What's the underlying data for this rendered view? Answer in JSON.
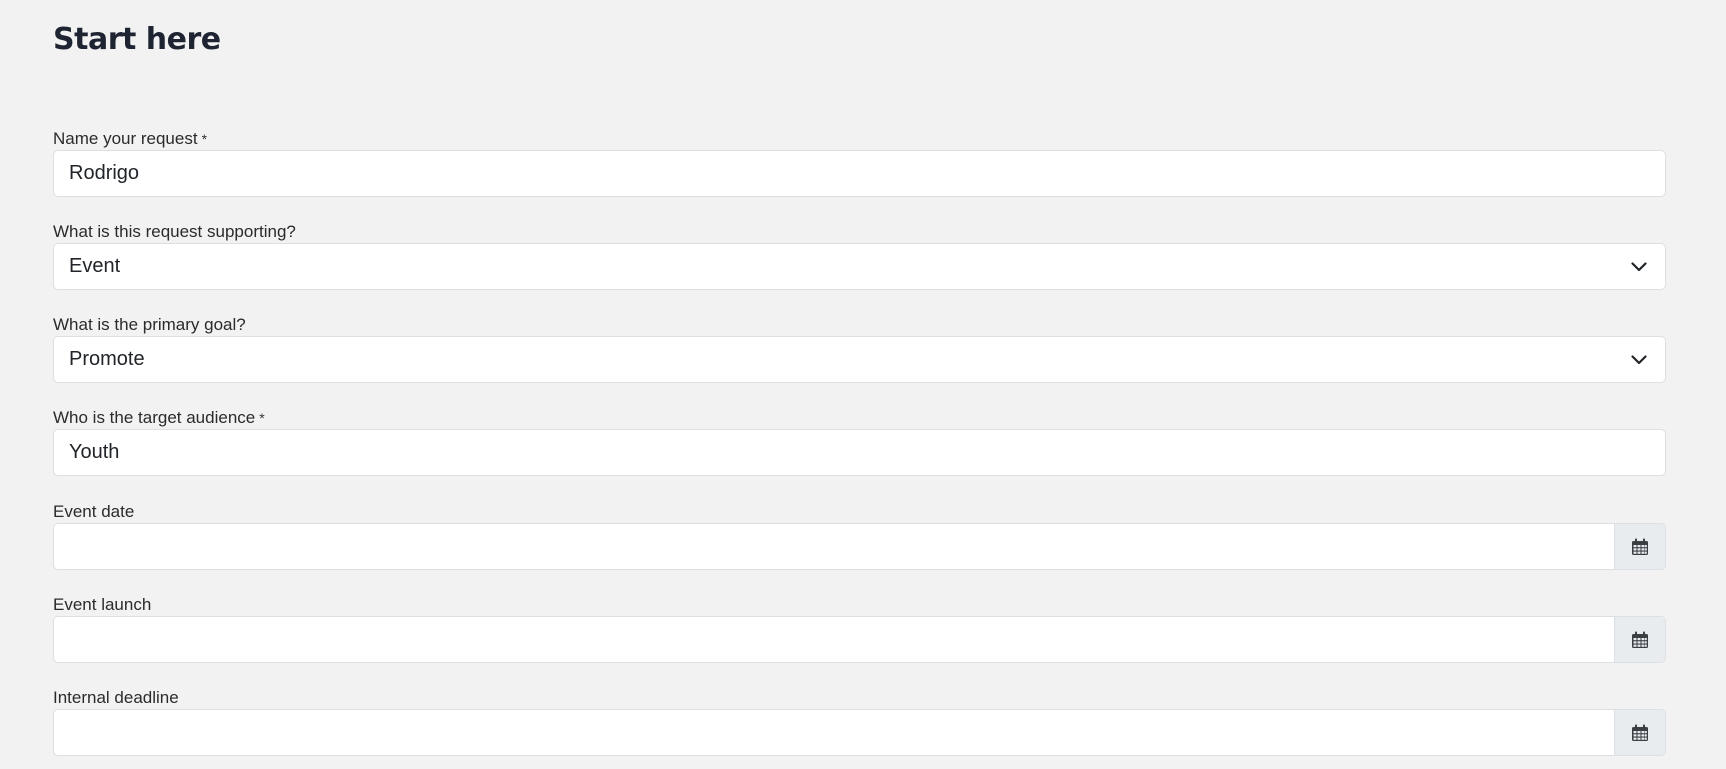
{
  "page": {
    "title": "Start here"
  },
  "form": {
    "request_name": {
      "label": "Name your request",
      "required_mark": "*",
      "value": "Rodrigo"
    },
    "supporting": {
      "label": "What is this request supporting?",
      "selected": "Event"
    },
    "primary_goal": {
      "label": "What is the primary goal?",
      "selected": "Promote"
    },
    "target_audience": {
      "label": "Who is the target audience",
      "required_mark": "*",
      "value": "Youth"
    },
    "event_date": {
      "label": "Event date",
      "value": "",
      "icon": "calendar-icon"
    },
    "event_launch": {
      "label": "Event launch",
      "value": "",
      "icon": "calendar-icon"
    },
    "internal_deadline": {
      "label": "Internal deadline",
      "value": "",
      "icon": "calendar-icon"
    }
  },
  "colors": {
    "background": "#f2f2f2",
    "input_bg": "#ffffff",
    "addon_bg": "#e9ecef",
    "border": "#dcdfe3",
    "title": "#1f2433"
  }
}
